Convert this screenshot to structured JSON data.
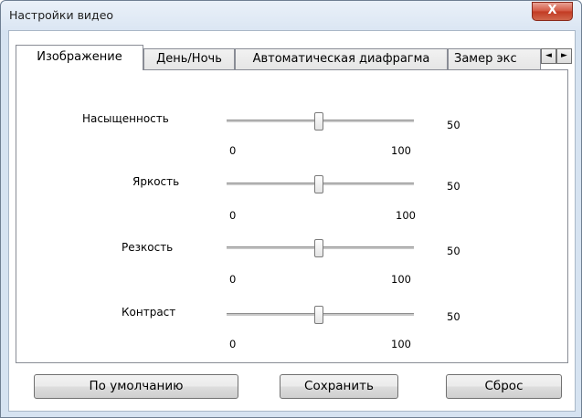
{
  "window": {
    "title": "Настройки видео",
    "close_label": "X"
  },
  "tabs": [
    {
      "label": "Изображение",
      "active": true
    },
    {
      "label": "День/Ночь",
      "active": false
    },
    {
      "label": "Автоматическая диафрагма",
      "active": false
    },
    {
      "label": "Замер экс",
      "active": false
    }
  ],
  "tab_scroll": {
    "left": "◄",
    "right": "►"
  },
  "sliders": [
    {
      "label": "Насыщенность",
      "min": "0",
      "max": "100",
      "value": "50"
    },
    {
      "label": "Яркость",
      "min": "0",
      "max": "100",
      "value": "50"
    },
    {
      "label": "Резкость",
      "min": "0",
      "max": "100",
      "value": "50"
    },
    {
      "label": "Контраст",
      "min": "0",
      "max": "100",
      "value": "50"
    }
  ],
  "buttons": {
    "default": "По умолчанию",
    "save": "Сохранить",
    "reset": "Сброс"
  }
}
